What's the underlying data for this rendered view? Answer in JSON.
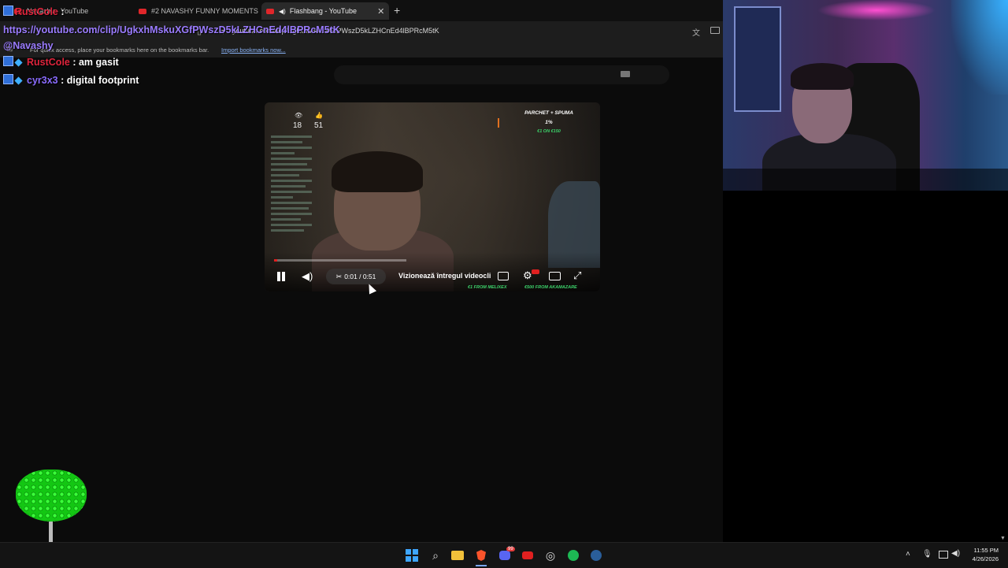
{
  "browser": {
    "tabs": [
      {
        "label": "Navashy - YouTube",
        "active": false
      },
      {
        "label": "#2 NAVASHY FUNNY MOMENTS",
        "active": false
      },
      {
        "label": "Flashbang - YouTube",
        "active": true
      }
    ],
    "url": "youtube.com/clip/UgkxhMskuXGfPWszD5kLZHCnEd4lBPRcM5tK",
    "bookmarks_hint": "For quick access, place your bookmarks here on the bookmarks bar.",
    "bookmarks_link": "Import bookmarks now..."
  },
  "video": {
    "views": "18",
    "likes": "51",
    "goal_title": "PARCHET + SPUMA",
    "goal_percent": "1%",
    "goal_amount": "€1 ON €150",
    "time": "0:01 / 0:51",
    "watch_full_label": "Vizionează întregul videocli",
    "donor_1": "€1 FROM MELIXEX",
    "donor_2": "€500 FROM AKAMAZARE",
    "progress_fraction": 0.02,
    "colors": {
      "progress": "#e02020",
      "goal_accent": "#3dd36b"
    }
  },
  "overlay_chat": {
    "lines": [
      {
        "user": "RustCole",
        "user_color": "#e0243c",
        "message": ""
      },
      {
        "user": "RustCole",
        "user_color": "#e0243c",
        "message": "am gasit"
      },
      {
        "user": "cyr3x3",
        "user_color": "#8b6cff",
        "message": "digital footprint"
      }
    ],
    "url_message": "https://youtube.com/clip/UgkxhMskuXGfPWszD5kLZHCnEd4lBPRcM5tK @Navashy"
  },
  "taskbar": {
    "time": "11:55 PM",
    "date": "4/26/2026",
    "discord_badge": "99"
  }
}
